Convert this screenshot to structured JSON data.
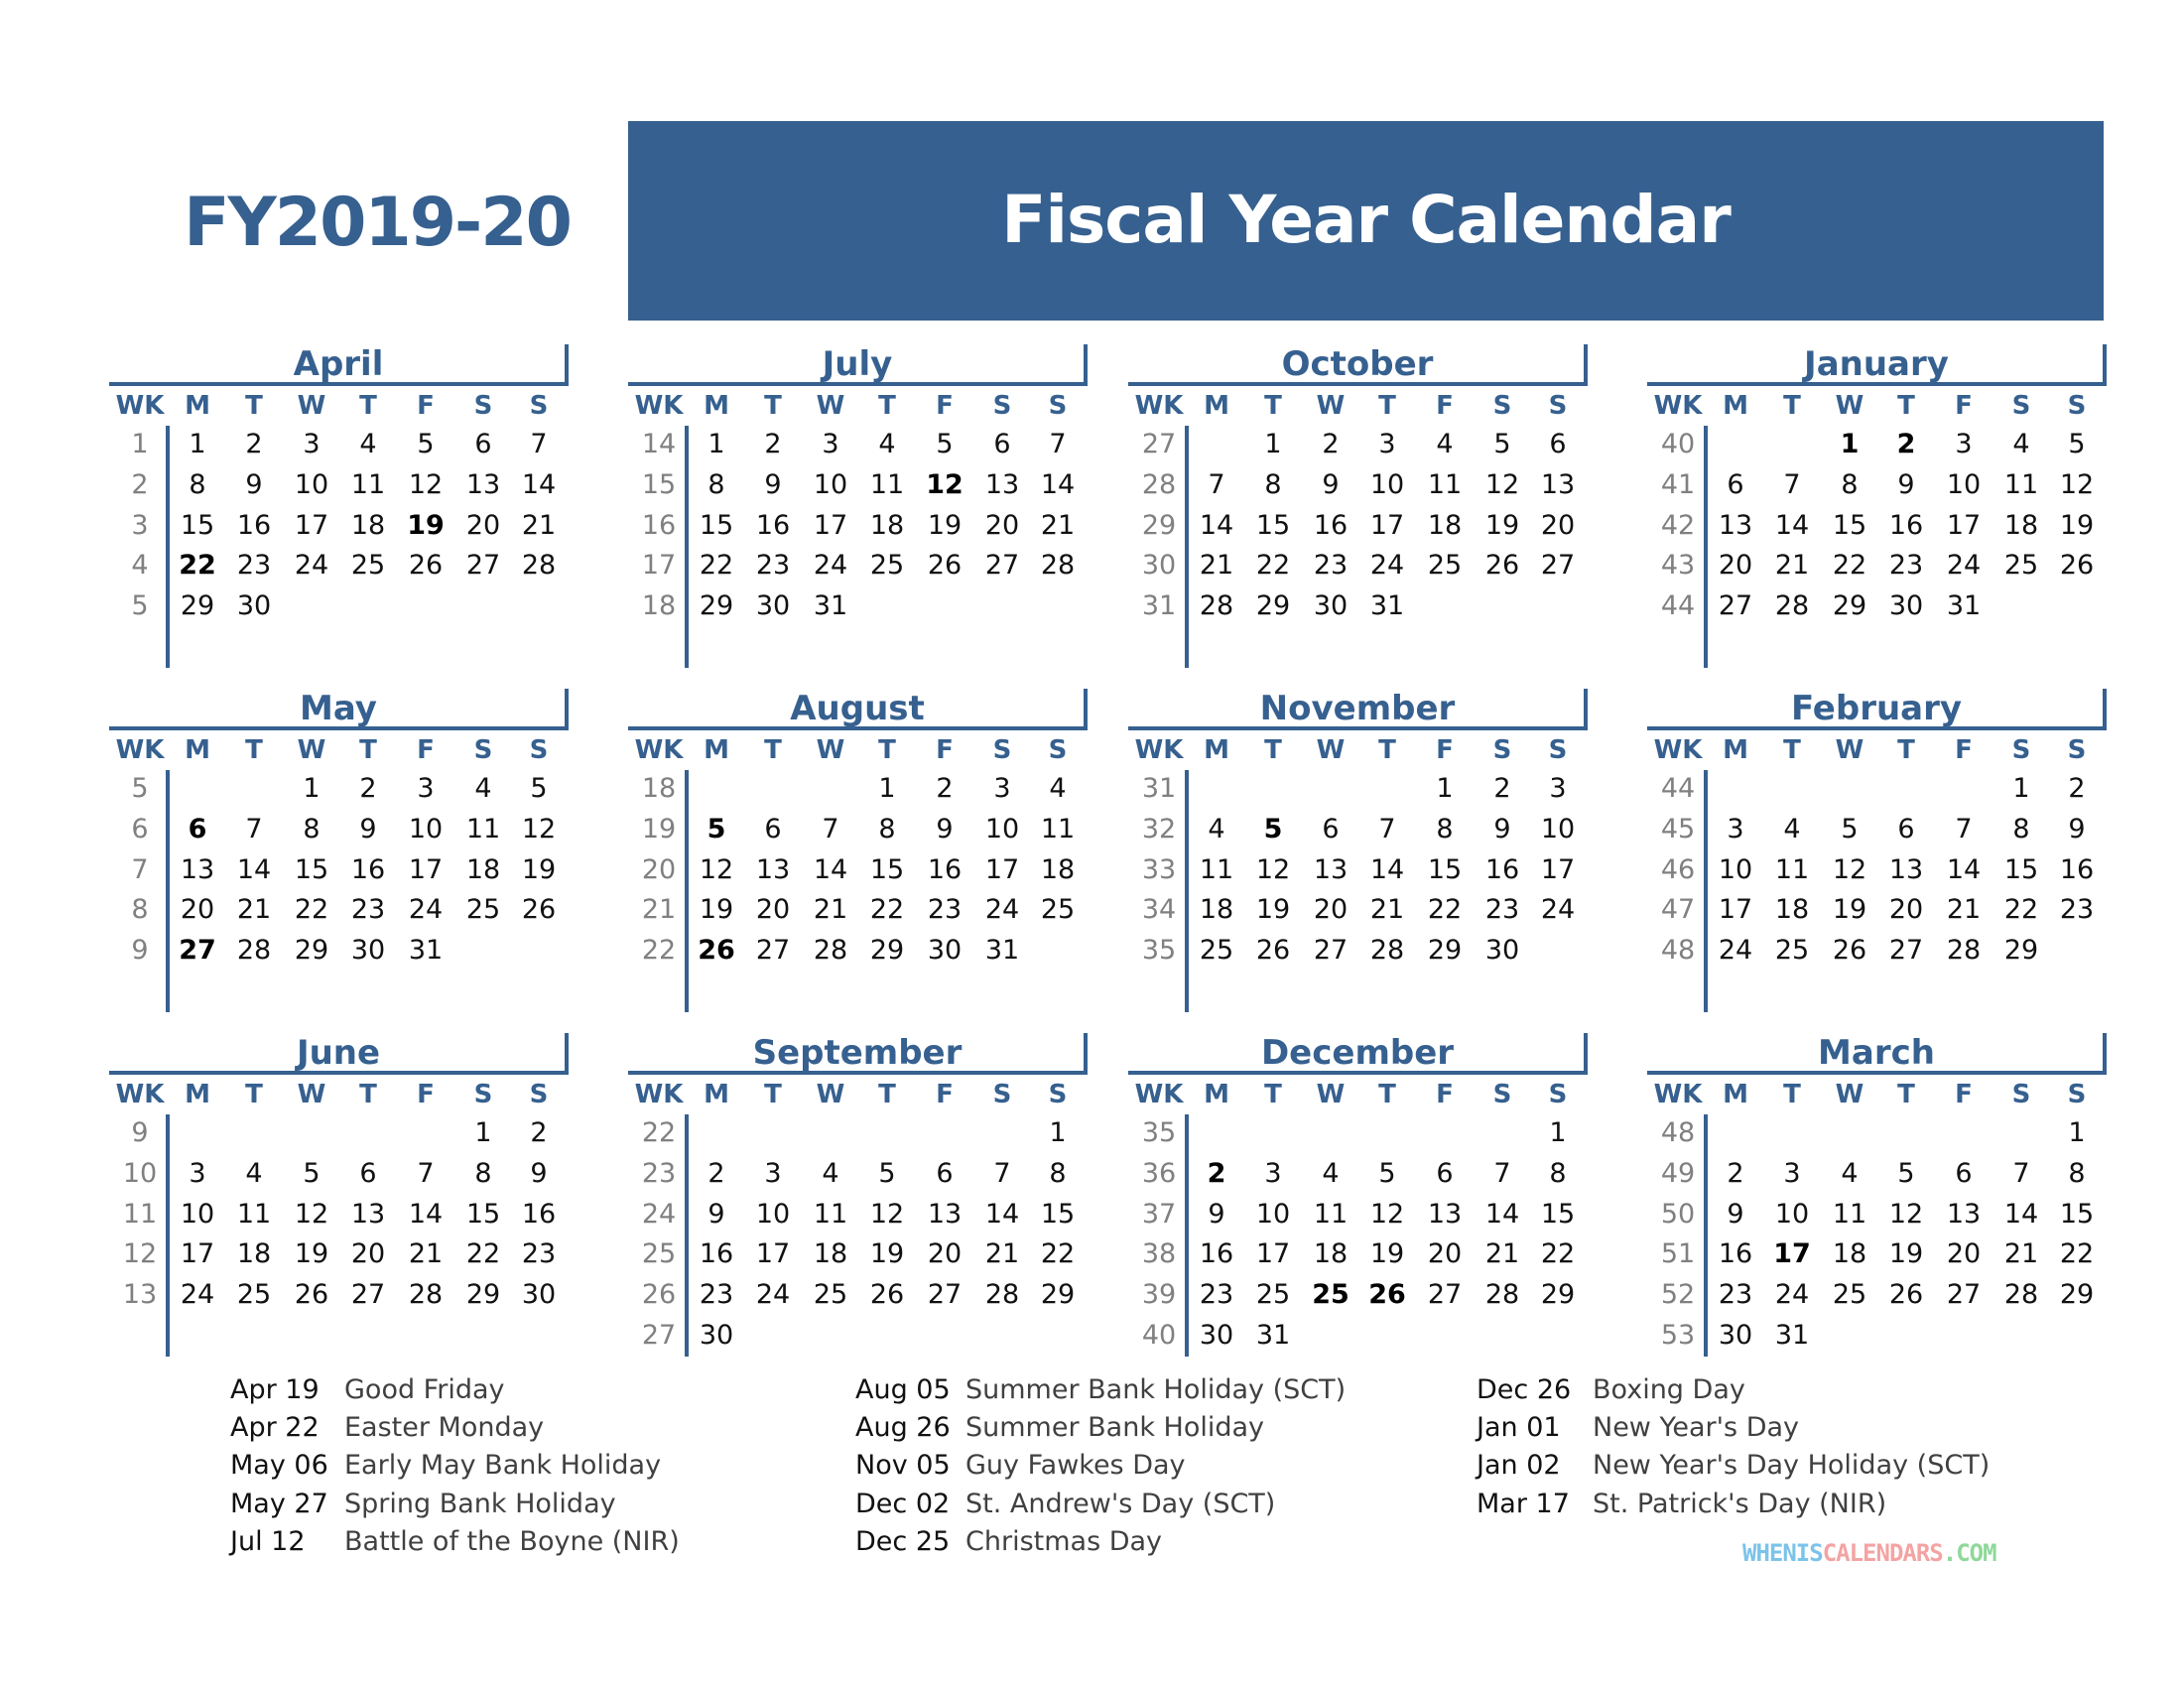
{
  "header": {
    "fy_label": "FY2019-20",
    "title": "Fiscal Year Calendar"
  },
  "colors": {
    "accent": "#36608f",
    "week_number": "#808080",
    "day": "#111111",
    "holiday_name": "#404040"
  },
  "day_headers": [
    "WK",
    "M",
    "T",
    "W",
    "T",
    "F",
    "S",
    "S"
  ],
  "months": [
    {
      "name": "April",
      "weeks": [
        {
          "wk": "1",
          "days": [
            "1",
            "2",
            "3",
            "4",
            "5",
            "6",
            "7"
          ]
        },
        {
          "wk": "2",
          "days": [
            "8",
            "9",
            "10",
            "11",
            "12",
            "13",
            "14"
          ]
        },
        {
          "wk": "3",
          "days": [
            "15",
            "16",
            "17",
            "18",
            "19",
            "20",
            "21"
          ]
        },
        {
          "wk": "4",
          "days": [
            "22",
            "23",
            "24",
            "25",
            "26",
            "27",
            "28"
          ]
        },
        {
          "wk": "5",
          "days": [
            "29",
            "30",
            "",
            "",
            "",
            "",
            ""
          ]
        }
      ],
      "bold": [
        "19",
        "22"
      ]
    },
    {
      "name": "July",
      "weeks": [
        {
          "wk": "14",
          "days": [
            "1",
            "2",
            "3",
            "4",
            "5",
            "6",
            "7"
          ]
        },
        {
          "wk": "15",
          "days": [
            "8",
            "9",
            "10",
            "11",
            "12",
            "13",
            "14"
          ]
        },
        {
          "wk": "16",
          "days": [
            "15",
            "16",
            "17",
            "18",
            "19",
            "20",
            "21"
          ]
        },
        {
          "wk": "17",
          "days": [
            "22",
            "23",
            "24",
            "25",
            "26",
            "27",
            "28"
          ]
        },
        {
          "wk": "18",
          "days": [
            "29",
            "30",
            "31",
            "",
            "",
            "",
            ""
          ]
        }
      ],
      "bold": [
        "12"
      ]
    },
    {
      "name": "October",
      "weeks": [
        {
          "wk": "27",
          "days": [
            "",
            "1",
            "2",
            "3",
            "4",
            "5",
            "6"
          ]
        },
        {
          "wk": "28",
          "days": [
            "7",
            "8",
            "9",
            "10",
            "11",
            "12",
            "13"
          ]
        },
        {
          "wk": "29",
          "days": [
            "14",
            "15",
            "16",
            "17",
            "18",
            "19",
            "20"
          ]
        },
        {
          "wk": "30",
          "days": [
            "21",
            "22",
            "23",
            "24",
            "25",
            "26",
            "27"
          ]
        },
        {
          "wk": "31",
          "days": [
            "28",
            "29",
            "30",
            "31",
            "",
            "",
            ""
          ]
        }
      ],
      "bold": []
    },
    {
      "name": "January",
      "weeks": [
        {
          "wk": "40",
          "days": [
            "",
            "",
            "1",
            "2",
            "3",
            "4",
            "5"
          ]
        },
        {
          "wk": "41",
          "days": [
            "6",
            "7",
            "8",
            "9",
            "10",
            "11",
            "12"
          ]
        },
        {
          "wk": "42",
          "days": [
            "13",
            "14",
            "15",
            "16",
            "17",
            "18",
            "19"
          ]
        },
        {
          "wk": "43",
          "days": [
            "20",
            "21",
            "22",
            "23",
            "24",
            "25",
            "26"
          ]
        },
        {
          "wk": "44",
          "days": [
            "27",
            "28",
            "29",
            "30",
            "31",
            "",
            ""
          ]
        }
      ],
      "bold": [
        "1",
        "2"
      ]
    },
    {
      "name": "May",
      "weeks": [
        {
          "wk": "5",
          "days": [
            "",
            "",
            "1",
            "2",
            "3",
            "4",
            "5"
          ]
        },
        {
          "wk": "6",
          "days": [
            "6",
            "7",
            "8",
            "9",
            "10",
            "11",
            "12"
          ]
        },
        {
          "wk": "7",
          "days": [
            "13",
            "14",
            "15",
            "16",
            "17",
            "18",
            "19"
          ]
        },
        {
          "wk": "8",
          "days": [
            "20",
            "21",
            "22",
            "23",
            "24",
            "25",
            "26"
          ]
        },
        {
          "wk": "9",
          "days": [
            "27",
            "28",
            "29",
            "30",
            "31",
            "",
            ""
          ]
        }
      ],
      "bold": [
        "6",
        "27"
      ]
    },
    {
      "name": "August",
      "weeks": [
        {
          "wk": "18",
          "days": [
            "",
            "",
            "",
            "1",
            "2",
            "3",
            "4"
          ]
        },
        {
          "wk": "19",
          "days": [
            "5",
            "6",
            "7",
            "8",
            "9",
            "10",
            "11"
          ]
        },
        {
          "wk": "20",
          "days": [
            "12",
            "13",
            "14",
            "15",
            "16",
            "17",
            "18"
          ]
        },
        {
          "wk": "21",
          "days": [
            "19",
            "20",
            "21",
            "22",
            "23",
            "24",
            "25"
          ]
        },
        {
          "wk": "22",
          "days": [
            "26",
            "27",
            "28",
            "29",
            "30",
            "31",
            ""
          ]
        }
      ],
      "bold": [
        "5",
        "26"
      ]
    },
    {
      "name": "November",
      "weeks": [
        {
          "wk": "31",
          "days": [
            "",
            "",
            "",
            "",
            "1",
            "2",
            "3"
          ]
        },
        {
          "wk": "32",
          "days": [
            "4",
            "5",
            "6",
            "7",
            "8",
            "9",
            "10"
          ]
        },
        {
          "wk": "33",
          "days": [
            "11",
            "12",
            "13",
            "14",
            "15",
            "16",
            "17"
          ]
        },
        {
          "wk": "34",
          "days": [
            "18",
            "19",
            "20",
            "21",
            "22",
            "23",
            "24"
          ]
        },
        {
          "wk": "35",
          "days": [
            "25",
            "26",
            "27",
            "28",
            "29",
            "30",
            ""
          ]
        }
      ],
      "bold": [
        "5"
      ]
    },
    {
      "name": "February",
      "weeks": [
        {
          "wk": "44",
          "days": [
            "",
            "",
            "",
            "",
            "",
            "1",
            "2"
          ]
        },
        {
          "wk": "45",
          "days": [
            "3",
            "4",
            "5",
            "6",
            "7",
            "8",
            "9"
          ]
        },
        {
          "wk": "46",
          "days": [
            "10",
            "11",
            "12",
            "13",
            "14",
            "15",
            "16"
          ]
        },
        {
          "wk": "47",
          "days": [
            "17",
            "18",
            "19",
            "20",
            "21",
            "22",
            "23"
          ]
        },
        {
          "wk": "48",
          "days": [
            "24",
            "25",
            "26",
            "27",
            "28",
            "29",
            ""
          ]
        }
      ],
      "bold": []
    },
    {
      "name": "June",
      "weeks": [
        {
          "wk": "9",
          "days": [
            "",
            "",
            "",
            "",
            "",
            "1",
            "2"
          ]
        },
        {
          "wk": "10",
          "days": [
            "3",
            "4",
            "5",
            "6",
            "7",
            "8",
            "9"
          ]
        },
        {
          "wk": "11",
          "days": [
            "10",
            "11",
            "12",
            "13",
            "14",
            "15",
            "16"
          ]
        },
        {
          "wk": "12",
          "days": [
            "17",
            "18",
            "19",
            "20",
            "21",
            "22",
            "23"
          ]
        },
        {
          "wk": "13",
          "days": [
            "24",
            "25",
            "26",
            "27",
            "28",
            "29",
            "30"
          ]
        }
      ],
      "bold": []
    },
    {
      "name": "September",
      "weeks": [
        {
          "wk": "22",
          "days": [
            "",
            "",
            "",
            "",
            "",
            "",
            "1"
          ]
        },
        {
          "wk": "23",
          "days": [
            "2",
            "3",
            "4",
            "5",
            "6",
            "7",
            "8"
          ]
        },
        {
          "wk": "24",
          "days": [
            "9",
            "10",
            "11",
            "12",
            "13",
            "14",
            "15"
          ]
        },
        {
          "wk": "25",
          "days": [
            "16",
            "17",
            "18",
            "19",
            "20",
            "21",
            "22"
          ]
        },
        {
          "wk": "26",
          "days": [
            "23",
            "24",
            "25",
            "26",
            "27",
            "28",
            "29"
          ]
        },
        {
          "wk": "27",
          "days": [
            "30",
            "",
            "",
            "",
            "",
            "",
            ""
          ]
        }
      ],
      "bold": []
    },
    {
      "name": "December",
      "weeks": [
        {
          "wk": "35",
          "days": [
            "",
            "",
            "",
            "",
            "",
            "",
            "1"
          ]
        },
        {
          "wk": "36",
          "days": [
            "2",
            "3",
            "4",
            "5",
            "6",
            "7",
            "8"
          ]
        },
        {
          "wk": "37",
          "days": [
            "9",
            "10",
            "11",
            "12",
            "13",
            "14",
            "15"
          ]
        },
        {
          "wk": "38",
          "days": [
            "16",
            "17",
            "18",
            "19",
            "20",
            "21",
            "22"
          ]
        },
        {
          "wk": "39",
          "days": [
            "23",
            "25",
            "25",
            "26",
            "27",
            "28",
            "29"
          ]
        },
        {
          "wk": "40",
          "days": [
            "30",
            "31",
            "",
            "",
            "",
            "",
            ""
          ]
        }
      ],
      "bold_cells": [
        [
          1,
          0
        ],
        [
          4,
          2
        ],
        [
          4,
          3
        ]
      ]
    },
    {
      "name": "March",
      "weeks": [
        {
          "wk": "48",
          "days": [
            "",
            "",
            "",
            "",
            "",
            "",
            "1"
          ]
        },
        {
          "wk": "49",
          "days": [
            "2",
            "3",
            "4",
            "5",
            "6",
            "7",
            "8"
          ]
        },
        {
          "wk": "50",
          "days": [
            "9",
            "10",
            "11",
            "12",
            "13",
            "14",
            "15"
          ]
        },
        {
          "wk": "51",
          "days": [
            "16",
            "17",
            "18",
            "19",
            "20",
            "21",
            "22"
          ]
        },
        {
          "wk": "52",
          "days": [
            "23",
            "24",
            "25",
            "26",
            "27",
            "28",
            "29"
          ]
        },
        {
          "wk": "53",
          "days": [
            "30",
            "31",
            "",
            "",
            "",
            "",
            ""
          ]
        }
      ],
      "bold": [
        "17"
      ]
    }
  ],
  "holidays": [
    [
      {
        "date": "Apr 19",
        "name": "Good Friday"
      },
      {
        "date": "Apr 22",
        "name": "Easter Monday"
      },
      {
        "date": "May 06",
        "name": "Early May Bank Holiday"
      },
      {
        "date": "May 27",
        "name": "Spring Bank Holiday"
      },
      {
        "date": "Jul 12",
        "name": "Battle of the Boyne (NIR)"
      }
    ],
    [
      {
        "date": "Aug 05",
        "name": "Summer Bank Holiday (SCT)"
      },
      {
        "date": "Aug 26",
        "name": "Summer Bank Holiday"
      },
      {
        "date": "Nov 05",
        "name": "Guy Fawkes Day"
      },
      {
        "date": "Dec 02",
        "name": "St. Andrew's Day (SCT)"
      },
      {
        "date": "Dec 25",
        "name": "Christmas Day"
      }
    ],
    [
      {
        "date": "Dec 26",
        "name": "Boxing Day"
      },
      {
        "date": "Jan 01",
        "name": "New Year's Day"
      },
      {
        "date": "Jan 02",
        "name": "New Year's Day Holiday (SCT)"
      },
      {
        "date": "Mar 17",
        "name": "St. Patrick's Day (NIR)"
      }
    ]
  ],
  "watermark": {
    "parts": [
      {
        "text": "WHENIS",
        "color": "#7cc3ea"
      },
      {
        "text": "CALENDARS",
        "color": "#f4a3a3"
      },
      {
        "text": ".COM",
        "color": "#8fd89a"
      }
    ]
  }
}
